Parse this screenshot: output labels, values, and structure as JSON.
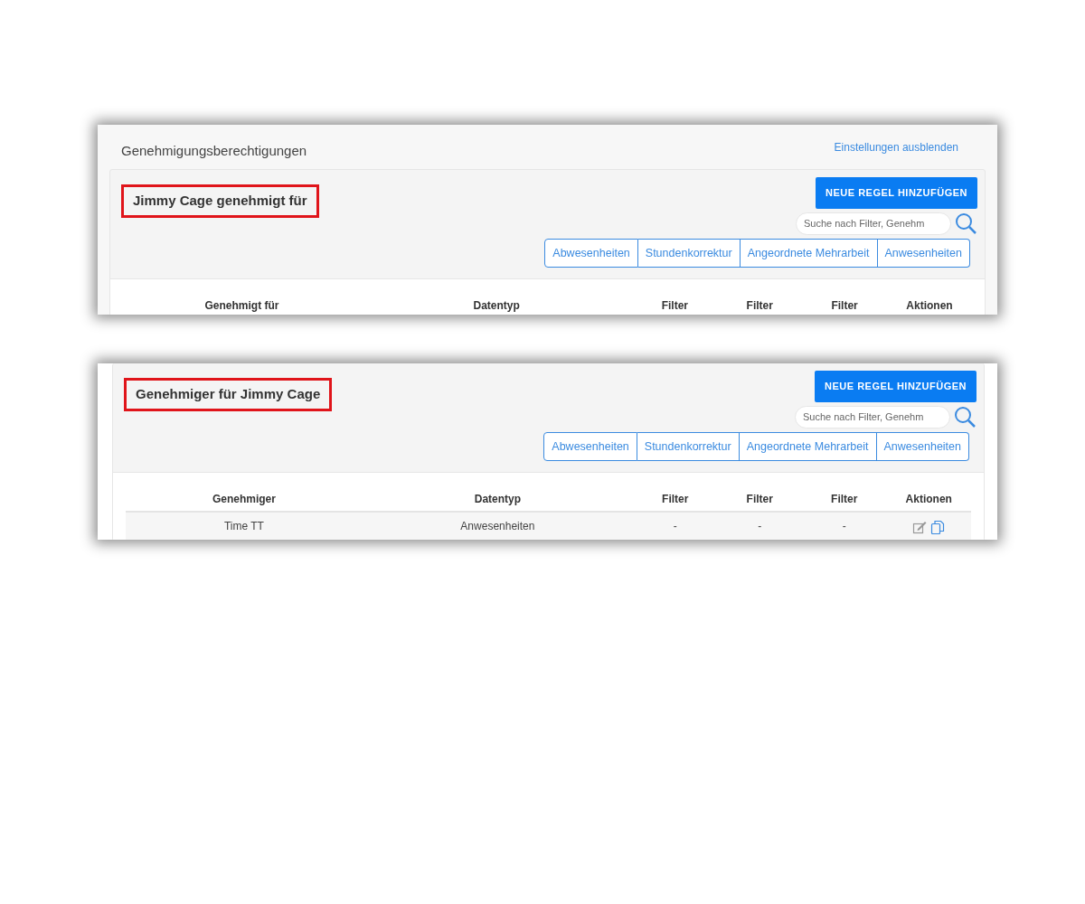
{
  "panels": [
    {
      "page_title": "Genehmigungsberechtigungen",
      "settings_link": "Einstellungen ausblenden",
      "heading": "Jimmy Cage genehmigt für",
      "heading_highlighted": true,
      "add_button": "NEUE REGEL HINZUFÜGEN",
      "search": {
        "placeholder": "Suche nach Filter, Genehm"
      },
      "filter_buttons": [
        "Abwesenheiten",
        "Stundenkorrektur",
        "Angeordnete Mehrarbeit",
        "Anwesenheiten"
      ],
      "table": {
        "columns": [
          "Genehmigt für",
          "Datentyp",
          "Filter",
          "Filter",
          "Filter",
          "Aktionen"
        ]
      }
    },
    {
      "heading": "Genehmiger für Jimmy Cage",
      "heading_highlighted": true,
      "add_button": "NEUE REGEL HINZUFÜGEN",
      "search": {
        "placeholder": "Suche nach Filter, Genehm"
      },
      "filter_buttons": [
        "Abwesenheiten",
        "Stundenkorrektur",
        "Angeordnete Mehrarbeit",
        "Anwesenheiten"
      ],
      "table": {
        "columns": [
          "Genehmiger",
          "Datentyp",
          "Filter",
          "Filter",
          "Filter",
          "Aktionen"
        ],
        "rows": [
          {
            "cells": [
              "Time TT",
              "Anwesenheiten",
              "-",
              "-",
              "-"
            ]
          }
        ]
      }
    }
  ]
}
